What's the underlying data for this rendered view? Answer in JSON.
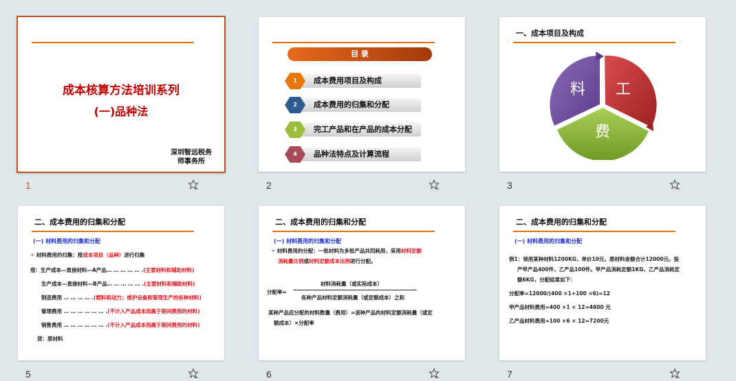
{
  "slides": [
    {
      "number": "1",
      "title_line1": "成本核算方法培训系列",
      "title_line2": "(一)品种法",
      "org_line1": "深圳智远税务",
      "org_line2": "师事务所"
    },
    {
      "number": "2",
      "toc_title": "目 录",
      "items": [
        {
          "n": "1",
          "label": "成本费用项目及构成"
        },
        {
          "n": "2",
          "label": "成本费用的归集和分配"
        },
        {
          "n": "3",
          "label": "完工产品和在产品的成本分配"
        },
        {
          "n": "4",
          "label": "品种法特点及计算流程"
        }
      ]
    },
    {
      "number": "3",
      "title": "一、成本项目及构成",
      "seg_liao": "料",
      "seg_gong": "工",
      "seg_fei": "费"
    },
    {
      "number": "5",
      "title": "二、成本费用的归集和分配",
      "sub": "(一) 材料费用的归集和分配",
      "l1a": "材料费用的归集：按",
      "l1b": "成本项目（品种）",
      "l1c": "进行归集",
      "l2a": "借：生产成本—直接材料—A产品… … … … … .",
      "l2b": "(主要材料和辅助材料)",
      "l3a": "生产成本—直接材料—B产品… … … … … .",
      "l3b": "(主要材料和辅助材料)",
      "l4a": "制造费用 … … … … .",
      "l4b": "(燃料和动力；维护设备和管理生产的各种材料)",
      "l5a": "管理费用 … … … … … … .",
      "l5b": "(不计入产品成本而属于期间费用的材料)",
      "l6a": "销售费用 … … … … … … .",
      "l6b": "(不计入产品成本而属于期间费用的材料)",
      "l7": "贷：原材料"
    },
    {
      "number": "6",
      "title": "二、成本费用的归集和分配",
      "sub": "(一) 材料费用的归集和分配",
      "p1a": "材料费用的分配：一批材料为多批产品共同耗用，采用",
      "p1b": "材料定额",
      "p2a": "消耗量比例",
      "p2b": "或",
      "p2c": "材料定额成本比例",
      "p2d": "进行分配。",
      "frac_label": "分配率=",
      "numerator": "材料消耗量（或实际成本）",
      "denominator": "各种产品材料定额消耗量（或定额成本）之和",
      "p3": "某种产品应分配的材料数量（费用）=该种产品的材料定额消耗量（或定",
      "p4": "额成本）×分配率"
    },
    {
      "number": "7",
      "title": "二、成本费用的归集和分配",
      "sub": "(一) 材料费用的归集和分配",
      "e1": "例1：领用某种材料1200KG，单价10元，原材料金额合计12000元，投",
      "e2": "产甲产品400件，乙产品100件。甲产品消耗定额1KG，乙产品消耗定",
      "e3": "额6KG，分配结果如下：",
      "e4": "分配率=12000/(400 ×1+100 ×6)=12",
      "e5": "甲产品材料费用=400 ×1 × 12=4800 元",
      "e6": "乙产品材料费用=100 ×6 × 12=7200元"
    }
  ],
  "colors": {
    "accent": "#e46c0a",
    "title_red": "#c00000",
    "blue": "#1a2ecc"
  },
  "icons": {
    "favorite": "star-outline-icon"
  }
}
